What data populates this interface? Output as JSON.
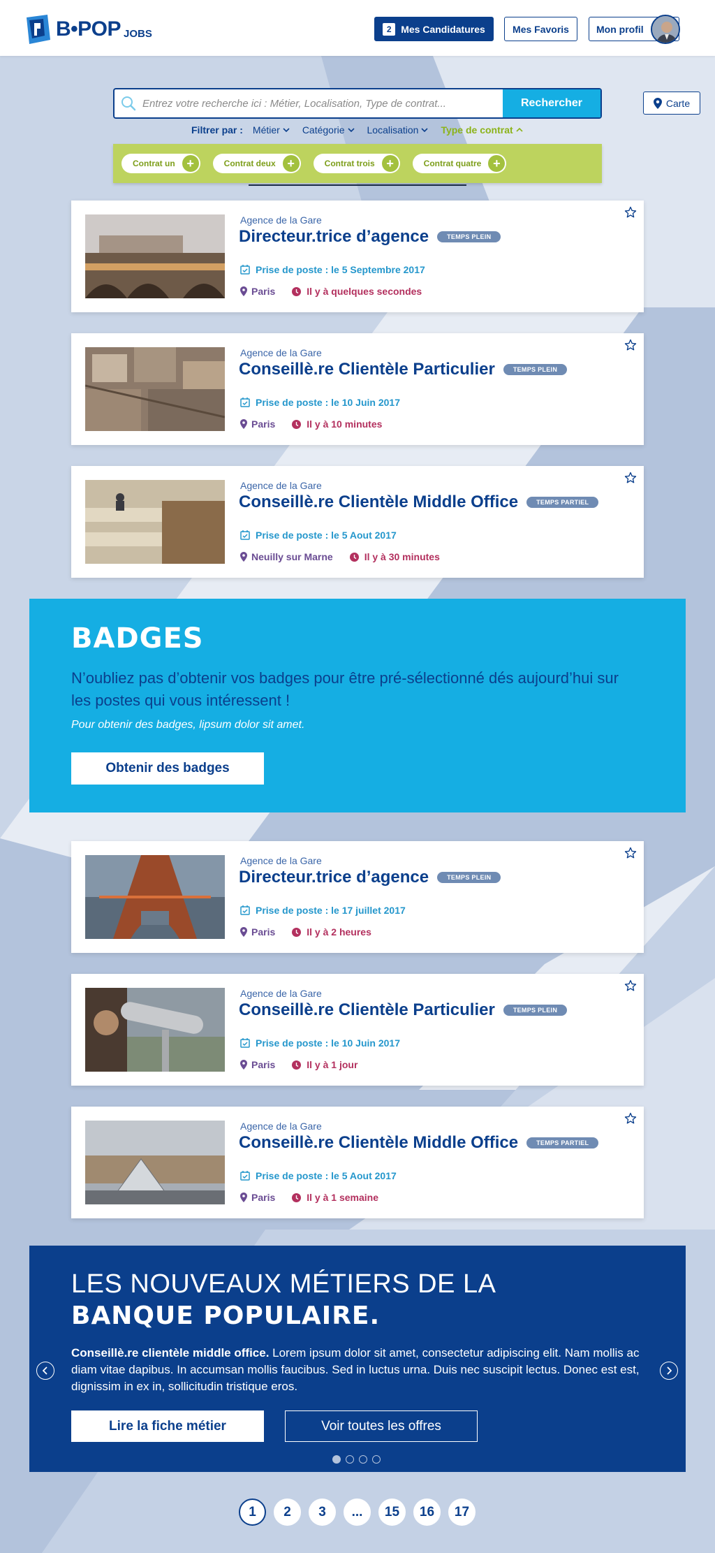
{
  "header": {
    "logo_text": "B•POP",
    "logo_sub": "JOBS",
    "applications_count": "2",
    "applications_label": "Mes Candidatures",
    "favorites_label": "Mes Favoris",
    "profile_label": "Mon profil"
  },
  "search": {
    "placeholder": "Entrez votre recherche ici : Métier, Localisation, Type de contrat...",
    "button_label": "Rechercher",
    "map_label": "Carte"
  },
  "filters": {
    "label": "Filtrer par :",
    "items": [
      "Métier",
      "Catégorie",
      "Localisation",
      "Type de contrat"
    ],
    "active_index": 3
  },
  "contracts": [
    "Contrat un",
    "Contrat deux",
    "Contrat trois",
    "Contrat quatre"
  ],
  "jobs": [
    {
      "agency": "Agence de la Gare",
      "title": "Directeur.trice d’agence",
      "badge": "TEMPS PLEIN",
      "date": "Prise de poste : le 5 Septembre 2017",
      "location": "Paris",
      "time": "Il y à quelques secondes"
    },
    {
      "agency": "Agence de la Gare",
      "title": "Conseillè.re Clientèle Particulier",
      "badge": "TEMPS PLEIN",
      "date": "Prise de poste : le 10 Juin 2017",
      "location": "Paris",
      "time": "Il y à 10 minutes"
    },
    {
      "agency": "Agence de la Gare",
      "title": "Conseillè.re Clientèle Middle Office",
      "badge": "TEMPS PARTIEL",
      "date": "Prise de poste : le 5 Aout 2017",
      "location": "Neuilly sur Marne",
      "time": "Il y à 30 minutes"
    },
    {
      "agency": "Agence de la Gare",
      "title": "Directeur.trice d’agence",
      "badge": "TEMPS PLEIN",
      "date": "Prise de poste : le 17 juillet 2017",
      "location": "Paris",
      "time": "Il y à 2 heures"
    },
    {
      "agency": "Agence de la Gare",
      "title": "Conseillè.re Clientèle Particulier",
      "badge": "TEMPS PLEIN",
      "date": "Prise de poste : le 10 Juin 2017",
      "location": "Paris",
      "time": "Il y à 1 jour"
    },
    {
      "agency": "Agence de la Gare",
      "title": "Conseillè.re Clientèle Middle Office",
      "badge": "TEMPS PARTIEL",
      "date": "Prise de poste : le 5 Aout 2017",
      "location": "Paris",
      "time": "Il y à 1 semaine"
    }
  ],
  "badges": {
    "title": "BADGES",
    "text": "N’oubliez pas d’obtenir vos badges pour être pré-sélectionné dés aujourd’hui sur les postes qui vous intéressent !",
    "subtext": "Pour obtenir des badges, lipsum dolor sit amet.",
    "button_label": "Obtenir des badges"
  },
  "banner": {
    "title_line1": "LES NOUVEAUX MÉTIERS DE LA",
    "title_line2": "BANQUE POPULAIRE.",
    "text_bold": "Conseillè.re clientèle middle office.",
    "text_body": " Lorem ipsum dolor sit amet, consectetur adipiscing elit. Nam mollis ac diam vitae dapibus. In accumsan mollis faucibus. Sed in luctus urna. Duis nec suscipit lectus. Donec est est, dignissim in ex in, sollicitudin tristique eros.",
    "button_primary": "Lire la fiche métier",
    "button_secondary": "Voir toutes les offres",
    "slide_count": 4,
    "active_slide": 1
  },
  "pagination": {
    "pages": [
      "1",
      "2",
      "3",
      "...",
      "15",
      "16",
      "17"
    ],
    "active": "1"
  },
  "colors": {
    "brand_dark": "#0b3f8c",
    "brand_cyan": "#15aee3",
    "accent_green": "#bdd35e",
    "background": "#b3c3dc",
    "time_color": "#b3305e",
    "location_color": "#6a4c93"
  }
}
